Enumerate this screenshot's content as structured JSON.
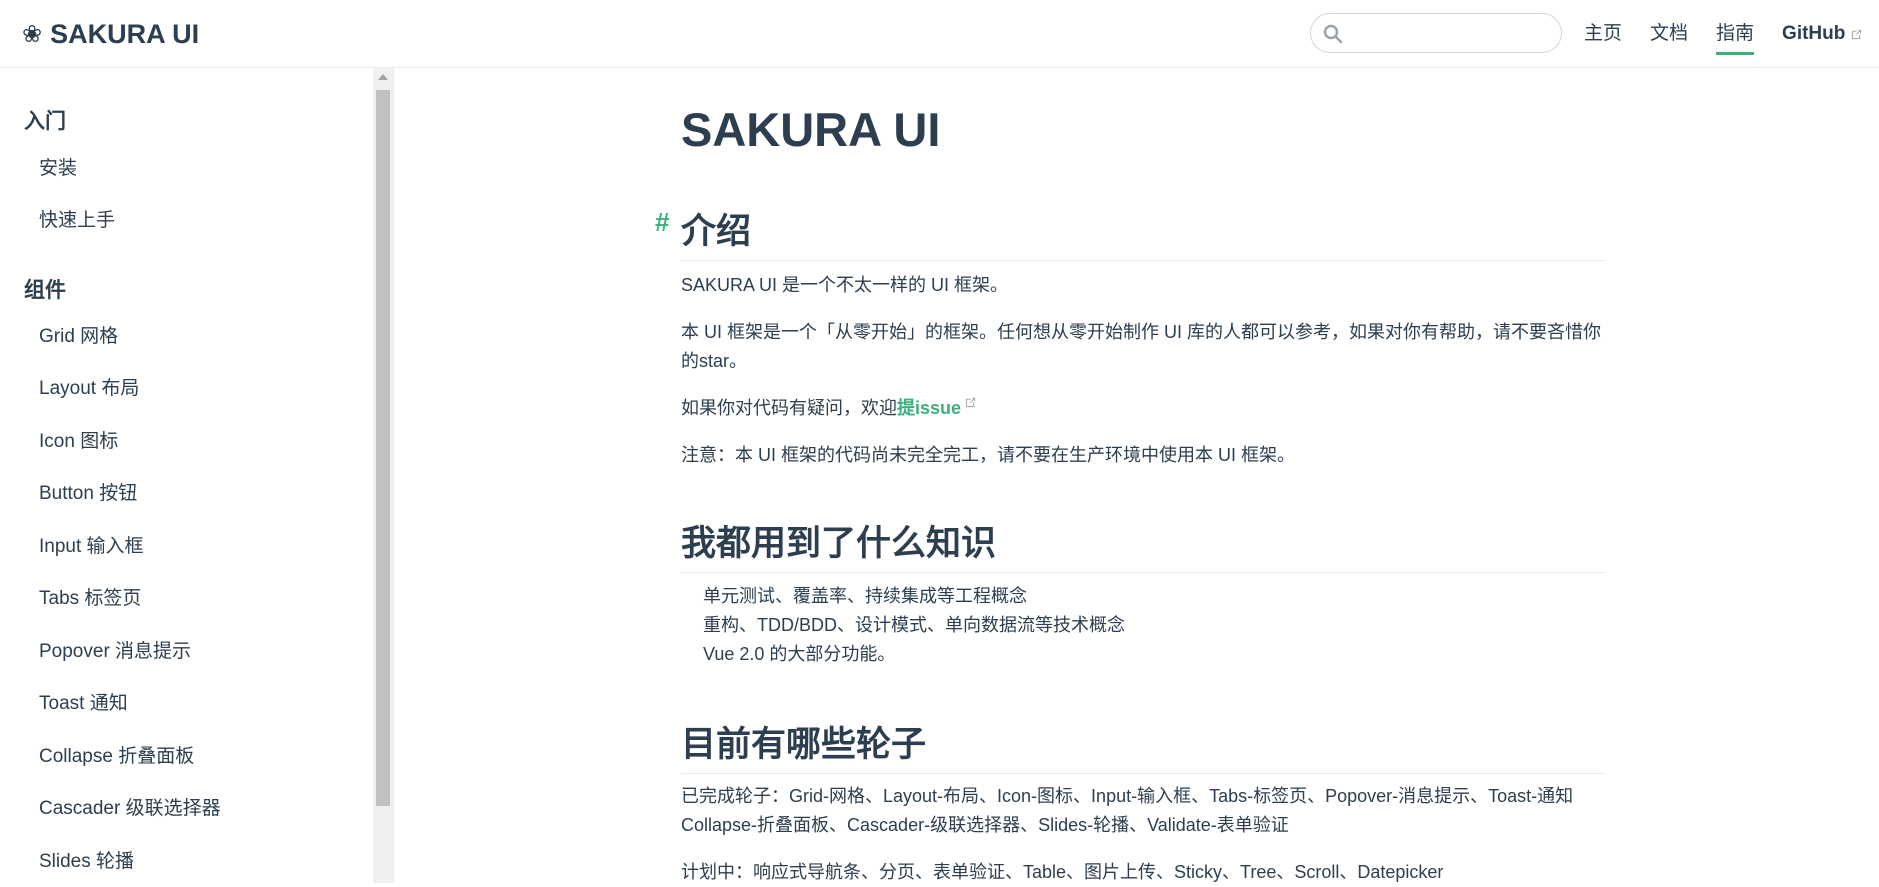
{
  "navbar": {
    "brand_icon": "sakura-flower-icon",
    "brand_icon_glyph": "❀",
    "brand": "SAKURA UI",
    "search": {
      "value": "",
      "placeholder": ""
    },
    "links": [
      {
        "label": "主页",
        "active": false
      },
      {
        "label": "文档",
        "active": false
      },
      {
        "label": "指南",
        "active": true
      },
      {
        "label": "GitHub",
        "external": true
      }
    ]
  },
  "sidebar": {
    "groups": [
      {
        "title": "入门",
        "items": [
          "安装",
          "快速上手"
        ]
      },
      {
        "title": "组件",
        "items": [
          "Grid 网格",
          "Layout 布局",
          "Icon 图标",
          "Button 按钮",
          "Input 输入框",
          "Tabs 标签页",
          "Popover 消息提示",
          "Toast 通知",
          "Collapse 折叠面板",
          "Cascader 级联选择器",
          "Slides 轮播"
        ]
      }
    ]
  },
  "content": {
    "title": "SAKURA UI",
    "sections": [
      {
        "anchor": "#",
        "heading": "介绍",
        "paragraphs": [
          "SAKURA UI 是一个不太一样的 UI 框架。",
          "本 UI 框架是一个「从零开始」的框架。任何想从零开始制作 UI 库的人都可以参考，如果对你有帮助，请不要吝惜你的star。",
          {
            "prefix": "如果你对代码有疑问，欢迎",
            "link": "提issue"
          },
          "注意：本 UI 框架的代码尚未完全完工，请不要在生产环境中使用本 UI 框架。"
        ]
      },
      {
        "heading": "我都用到了什么知识",
        "list": [
          "单元测试、覆盖率、持续集成等工程概念",
          "重构、TDD/BDD、设计模式、单向数据流等技术概念",
          "Vue 2.0 的大部分功能。"
        ]
      },
      {
        "heading": "目前有哪些轮子",
        "paragraphs": [
          "已完成轮子：Grid-网格、Layout-布局、Icon-图标、Input-输入框、Tabs-标签页、Popover-消息提示、Toast-通知 Collapse-折叠面板、Cascader-级联选择器、Slides-轮播、Validate-表单验证",
          "计划中：响应式导航条、分页、表单验证、Table、图片上传、Sticky、Tree、Scroll、Datepicker"
        ]
      }
    ]
  },
  "colors": {
    "accent": "#3eaf7c",
    "text": "#2c3e50",
    "border": "#eaecef"
  }
}
